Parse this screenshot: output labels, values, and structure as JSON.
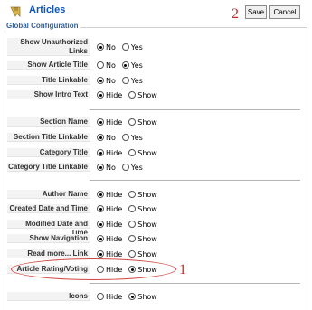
{
  "header": {
    "title": "Articles",
    "icon": "articles-icon",
    "save_label": "Save",
    "cancel_label": "Cancel"
  },
  "annotations": {
    "save_cancel": "2",
    "rating": "1"
  },
  "fieldset": {
    "legend": "Global Configuration"
  },
  "rows": [
    {
      "label": "Show Unauthorized Links",
      "options": [
        "No",
        "Yes"
      ],
      "selected": "No"
    },
    {
      "label": "Show Article Title",
      "options": [
        "No",
        "Yes"
      ],
      "selected": "Yes"
    },
    {
      "label": "Title Linkable",
      "options": [
        "No",
        "Yes"
      ],
      "selected": "No"
    },
    {
      "label": "Show Intro Text",
      "options": [
        "Hide",
        "Show"
      ],
      "selected": "Hide"
    },
    {
      "label": "Section Name",
      "options": [
        "Hide",
        "Show"
      ],
      "selected": "Hide"
    },
    {
      "label": "Section Title Linkable",
      "options": [
        "No",
        "Yes"
      ],
      "selected": "No"
    },
    {
      "label": "Category Title",
      "options": [
        "Hide",
        "Show"
      ],
      "selected": "Hide"
    },
    {
      "label": "Category Title Linkable",
      "options": [
        "No",
        "Yes"
      ],
      "selected": "No"
    },
    {
      "label": "Author Name",
      "options": [
        "Hide",
        "Show"
      ],
      "selected": "Hide"
    },
    {
      "label": "Created Date and Time",
      "options": [
        "Hide",
        "Show"
      ],
      "selected": "Hide"
    },
    {
      "label": "Modified Date and Time",
      "options": [
        "Hide",
        "Show"
      ],
      "selected": "Hide"
    },
    {
      "label": "Show Navigation",
      "options": [
        "Hide",
        "Show"
      ],
      "selected": "Hide"
    },
    {
      "label": "Read more... Link",
      "options": [
        "Hide",
        "Show"
      ],
      "selected": "Hide"
    },
    {
      "label": "Article Rating/Voting",
      "options": [
        "Hide",
        "Show"
      ],
      "selected": "Show"
    },
    {
      "label": "Icons",
      "options": [
        "Hide",
        "Show"
      ],
      "selected": "Show"
    }
  ],
  "colors": {
    "title": "#0b55c4",
    "annotation": "#c0302b",
    "legend": "#335f96"
  }
}
